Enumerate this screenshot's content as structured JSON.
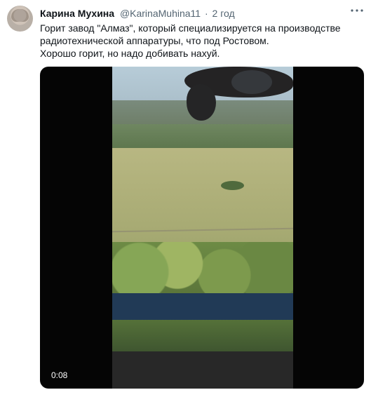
{
  "tweet": {
    "author_name": "Карина Мухина",
    "author_handle": "@KarinaMuhina11",
    "separator": "·",
    "timestamp": "2 год",
    "text_lines": [
      "Горит завод \"Алмаз\", который специализируется на производстве",
      "радиотехнической аппаратуры, что под Ростовом.",
      "Хорошо горит, но надо добивать нахуй."
    ],
    "icons": {
      "more": "more-options-icon"
    },
    "media": {
      "type": "video",
      "duration": "0:08"
    }
  },
  "colors": {
    "name": "#0f1419",
    "secondary": "#536471",
    "media_background": "#050505"
  }
}
